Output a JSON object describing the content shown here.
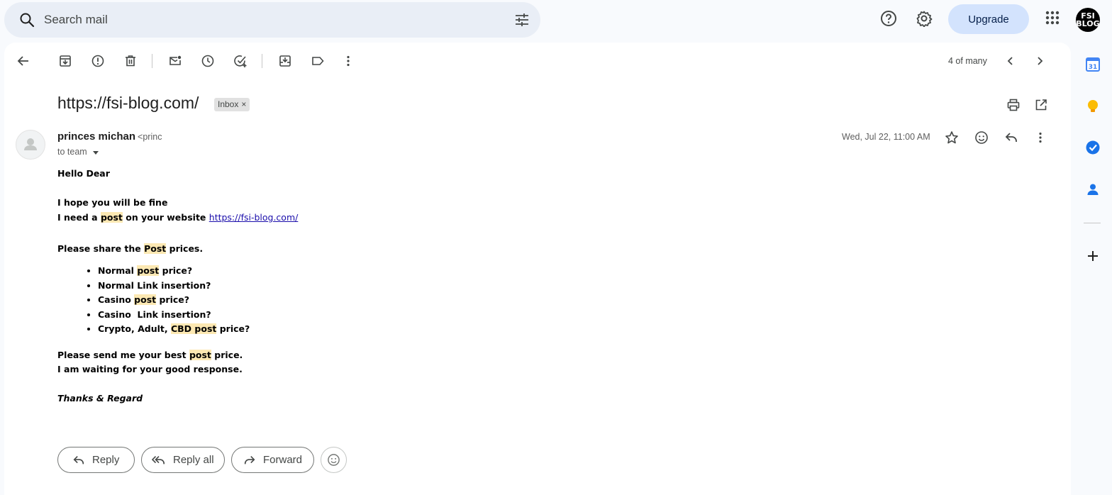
{
  "search": {
    "placeholder": "Search mail"
  },
  "header": {
    "upgrade_label": "Upgrade",
    "avatar_text": "FSI BLOG"
  },
  "toolbar": {
    "pager": "4 of many"
  },
  "message": {
    "subject": "https://fsi-blog.com/",
    "label": "Inbox",
    "label_remove": "×",
    "sender_name": "princes michan",
    "sender_email": "<princ",
    "to": "to team",
    "date": "Wed, Jul 22, 11:00 AM",
    "body": {
      "greeting": "Hello Dear",
      "line1": "I hope you will be fine",
      "line2_pre": "I need a ",
      "hl_post": "post",
      "line2_post": " on your website ",
      "link": "https://fsi-blog.com/",
      "line3_pre": "Please share the ",
      "hl_Post": "Post",
      "line3_post": " prices.",
      "bullets": {
        "b1_pre": "Normal ",
        "b1_post": " price?",
        "b2": "Normal Link insertion?",
        "b3_pre": "Casino ",
        "b3_post": " price?",
        "b4": "Casino  Link insertion?",
        "b5_pre": "Crypto, Adult, ",
        "hl_cbd": "CBD",
        "b5_post": " price?"
      },
      "line4_pre": "Please send me your best ",
      "line4_post": " price.",
      "line5": "I am waiting for your good response.",
      "signature": "Thanks & Regard"
    }
  },
  "actions": {
    "reply": "Reply",
    "reply_all": "Reply all",
    "forward": "Forward"
  },
  "colors": {
    "highlight": "#fce8b2",
    "upgrade_bg": "#d3e3fd",
    "link": "#1a0dab"
  }
}
